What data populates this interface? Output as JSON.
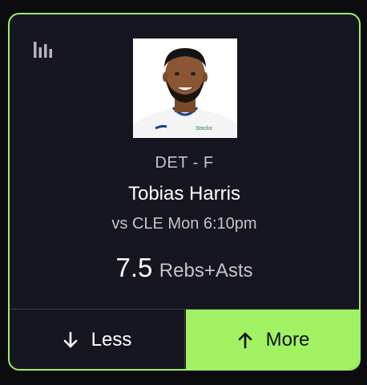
{
  "card": {
    "stats_icon": "bar-chart-icon",
    "player_photo": "player-headshot",
    "team_position": "DET - F",
    "player_name": "Tobias Harris",
    "game_info": "vs CLE Mon 6:10pm",
    "line_value": "7.5",
    "line_stat": "Rebs+Asts"
  },
  "actions": {
    "less_label": "Less",
    "less_icon": "arrow-down-icon",
    "more_label": "More",
    "more_icon": "arrow-up-icon"
  },
  "colors": {
    "accent_green": "#a0f263",
    "card_border": "#a0ee6b",
    "card_background": "#161620",
    "page_background": "#0c0c0f"
  }
}
